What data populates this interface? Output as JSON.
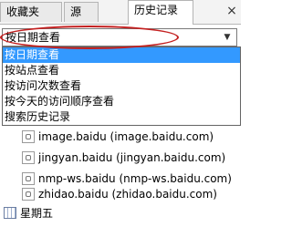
{
  "tabs": [
    {
      "label": "收藏夹"
    },
    {
      "label": "源"
    },
    {
      "label": "历史记录"
    }
  ],
  "close_glyph": "×",
  "view_select": {
    "selected": "按日期查看",
    "options": [
      "按日期查看",
      "按站点查看",
      "按访问次数查看",
      "按今天的访问顺序查看",
      "搜索历史记录"
    ]
  },
  "history_items": [
    {
      "text": "image.baidu (image.baidu.com)",
      "icon": "page-icon"
    },
    {
      "text": "jingyan.baidu (jingyan.baidu.com)",
      "icon": "page-icon"
    },
    {
      "text": "nmp-ws.baidu (nmp-ws.baidu.com)",
      "icon": "page-icon"
    },
    {
      "text": "zhidao.baidu (zhidao.baidu.com)",
      "icon": "page-icon"
    }
  ],
  "day_group": {
    "label": "星期五",
    "icon": "calendar-icon"
  },
  "colors": {
    "selection": "#3399ff",
    "highlight_ellipse": "#c32020"
  }
}
